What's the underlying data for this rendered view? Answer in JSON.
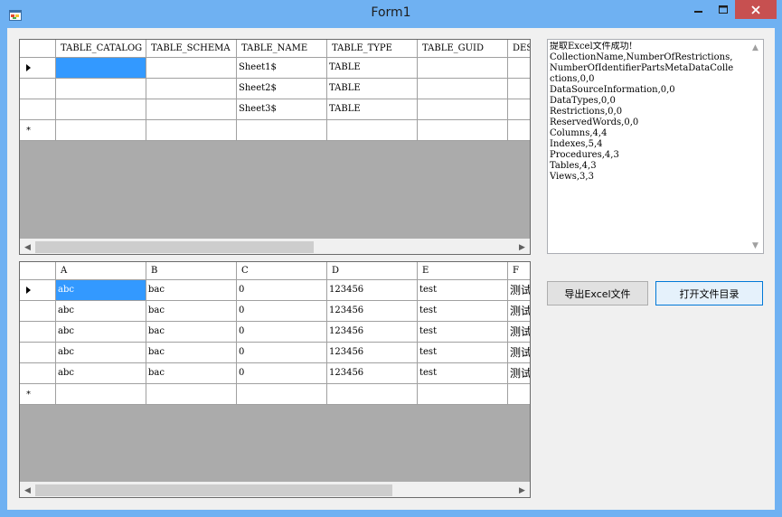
{
  "window": {
    "title": "Form1",
    "icon": "app-form-icon",
    "controls": {
      "minimize": "minimize-icon",
      "maximize": "maximize-icon",
      "close": "close-icon"
    }
  },
  "schema_grid": {
    "columns": [
      "TABLE_CATALOG",
      "TABLE_SCHEMA",
      "TABLE_NAME",
      "TABLE_TYPE",
      "TABLE_GUID",
      "DES"
    ],
    "rows": [
      [
        "",
        "",
        "Sheet1$",
        "TABLE",
        "",
        ""
      ],
      [
        "",
        "",
        "Sheet2$",
        "TABLE",
        "",
        ""
      ],
      [
        "",
        "",
        "Sheet3$",
        "TABLE",
        "",
        ""
      ]
    ],
    "new_row_marker": "*"
  },
  "data_grid": {
    "columns": [
      "A",
      "B",
      "C",
      "D",
      "E",
      "F"
    ],
    "rows": [
      [
        "abc",
        "bac",
        "0",
        "123456",
        "test",
        "测试"
      ],
      [
        "abc",
        "bac",
        "0",
        "123456",
        "test",
        "测试"
      ],
      [
        "abc",
        "bac",
        "0",
        "123456",
        "test",
        "测试"
      ],
      [
        "abc",
        "bac",
        "0",
        "123456",
        "test",
        "测试"
      ],
      [
        "abc",
        "bac",
        "0",
        "123456",
        "test",
        "测试"
      ]
    ],
    "new_row_marker": "*"
  },
  "log": {
    "lines": [
      "提取Excel文件成功!",
      "CollectionName,NumberOfRestrictions,",
      "NumberOfIdentifierPartsMetaDataColle",
      "ctions,0,0",
      "DataSourceInformation,0,0",
      "DataTypes,0,0",
      "Restrictions,0,0",
      "ReservedWords,0,0",
      "Columns,4,4",
      "Indexes,5,4",
      "Procedures,4,3",
      "Tables,4,3",
      "Views,3,3"
    ]
  },
  "buttons": {
    "export": "导出Excel文件",
    "open_dir": "打开文件目录"
  },
  "colors": {
    "titlebar": "#6fb1f2",
    "selection": "#3399ff",
    "close_button": "#c75050",
    "grid_empty_area": "#ababab"
  }
}
